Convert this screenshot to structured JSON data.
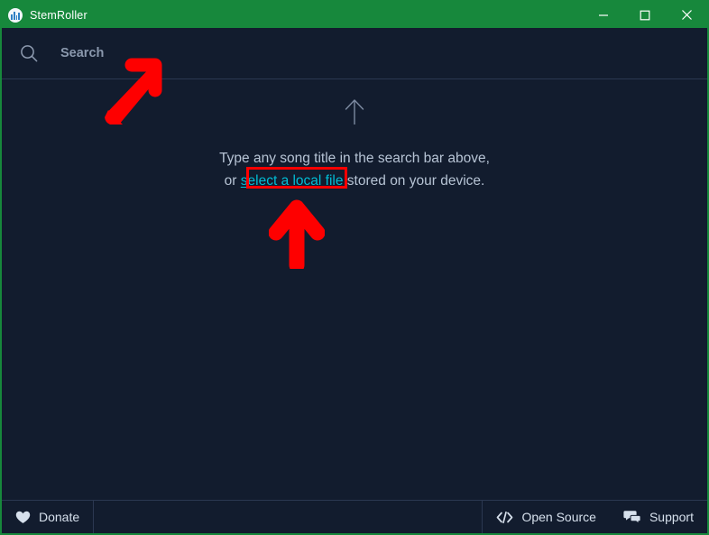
{
  "window": {
    "title": "StemRoller",
    "app_icon": "equalizer-icon",
    "accent_color": "#17883c",
    "background_color": "#121c2e",
    "controls": [
      {
        "name": "minimize",
        "glyph": "–"
      },
      {
        "name": "maximize",
        "glyph": "□"
      },
      {
        "name": "close",
        "glyph": "✕"
      }
    ]
  },
  "search": {
    "icon": "search-icon",
    "value": "",
    "placeholder": "Search"
  },
  "main": {
    "hint_icon": "arrow-up-icon",
    "line1": "Type any song title in the search bar above,",
    "line2_prefix": "or ",
    "link_label": "select a local file",
    "line2_suffix": " stored on your device.",
    "link_color": "#00bcd4",
    "text_color": "#b6c3d4"
  },
  "annotations": {
    "color": "#fe0000",
    "arrow1": "red-arrow-pointing-to-search-bar",
    "arrow2": "red-arrow-pointing-to-select-a-local-file-link",
    "highlight_box": "red-box-around-select-a-local-file-link"
  },
  "bottom_bar": {
    "donate": {
      "icon": "heart-icon",
      "label": "Donate"
    },
    "open_source": {
      "icon": "code-icon",
      "label": "Open Source"
    },
    "support": {
      "icon": "chat-bubbles-icon",
      "label": "Support"
    }
  }
}
